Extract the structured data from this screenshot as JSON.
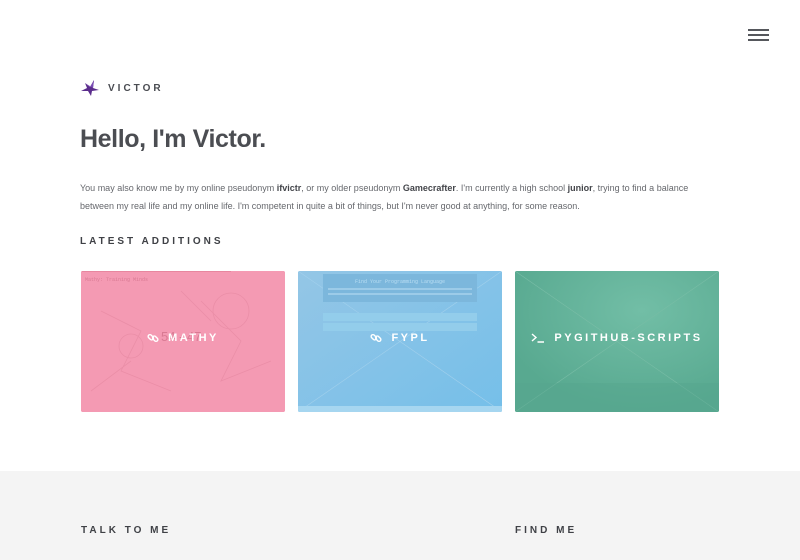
{
  "header": {
    "logo_text": "VICTOR",
    "menu_icon": "hamburger-icon"
  },
  "hero": {
    "title": "Hello, I'm Victor.",
    "intro_1": "You may also know me by my online pseudonym ",
    "pseudonym_1": "ifvictr",
    "intro_2": ", or my older pseudonym ",
    "pseudonym_2": "Gamecrafter",
    "intro_3": ". I'm currently a high school ",
    "grade": "junior",
    "intro_4": ", trying to find a balance between my real life and my online life. I'm competent in quite a bit of things, but I'm never good at anything, for some reason."
  },
  "latest": {
    "title": "LATEST ADDITIONS",
    "cards": [
      {
        "label": "MATHY",
        "icon": "link-icon",
        "color": "#f49ab3",
        "overlay_text": "54 - 47",
        "overlay_heading": "Mathy: Training Minds"
      },
      {
        "label": "FYPL",
        "icon": "link-icon",
        "color": "#87c3e6",
        "overlay_heading": "Find Your Programming Language"
      },
      {
        "label": "PYGITHUB-SCRIPTS",
        "icon": "terminal-icon",
        "color": "#5fae98"
      }
    ]
  },
  "footer": {
    "talk_title": "TALK TO ME",
    "find_title": "FIND ME"
  }
}
